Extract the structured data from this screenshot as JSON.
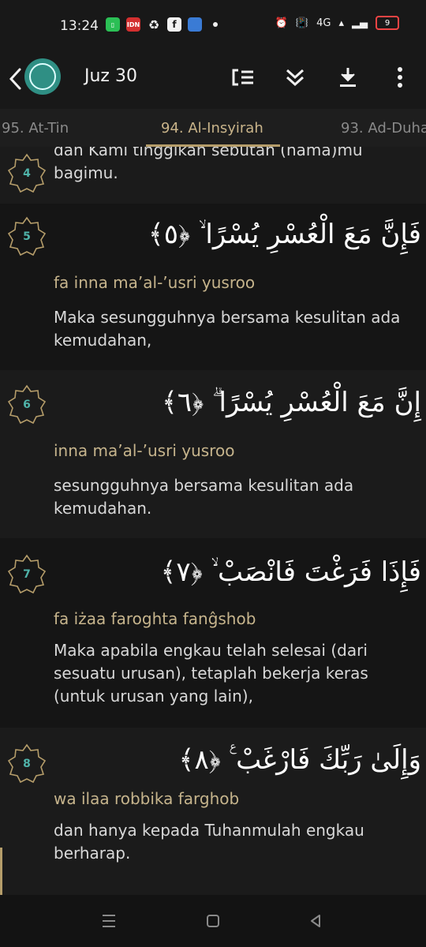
{
  "status": {
    "time": "13:24",
    "icon_label_idn": "IDN",
    "signal": "4G",
    "battery": "9"
  },
  "appbar": {
    "title": "Juz 30",
    "icons": [
      "back-icon",
      "quran-logo",
      "list-indent-icon",
      "double-chevron-down-icon",
      "download-icon",
      "more-vert-icon"
    ]
  },
  "tabs": [
    {
      "label": "95. At-Tin"
    },
    {
      "label": "94. Al-Insyirah"
    },
    {
      "label": "93. Ad-Duha"
    }
  ],
  "verses": [
    {
      "number": "4",
      "translation": "dan Kami tinggikan sebutan (nama)mu bagimu."
    },
    {
      "number": "5",
      "arabic": "فَإِنَّ مَعَ الْعُسْرِ يُسْرًا ۙ ﴿٥﴾",
      "translit": "fa inna ma’al-’usri yusroo",
      "translation": "Maka sesungguhnya bersama kesulitan ada kemudahan,"
    },
    {
      "number": "6",
      "arabic": "إِنَّ مَعَ الْعُسْرِ يُسْرًا ۗ ﴿٦﴾",
      "translit": "inna ma’al-’usri yusroo",
      "translation": "sesungguhnya bersama kesulitan ada kemudahan."
    },
    {
      "number": "7",
      "arabic": "فَإِذَا فَرَغْتَ فَانْصَبْ ۙ ﴿٧﴾",
      "translit": "fa iżaa faroghta fanĝshob",
      "translation": "Maka apabila engkau telah selesai (dari sesuatu urusan), tetaplah bekerja keras (untuk urusan yang lain),"
    },
    {
      "number": "8",
      "arabic": "وَإِلَىٰ رَبِّكَ فَارْغَبْ ࣖ ﴿٨﴾",
      "translit": "wa ilaa robbika farghob",
      "translation": "dan hanya kepada Tuhanmulah engkau berharap."
    }
  ],
  "colors": {
    "accent_gold": "#c6b48c",
    "verse_number_teal": "#4fb3a9",
    "logo_teal": "#2f8f84"
  },
  "navbar": {
    "icons": [
      "recents-icon",
      "home-icon",
      "back-nav-icon"
    ]
  }
}
